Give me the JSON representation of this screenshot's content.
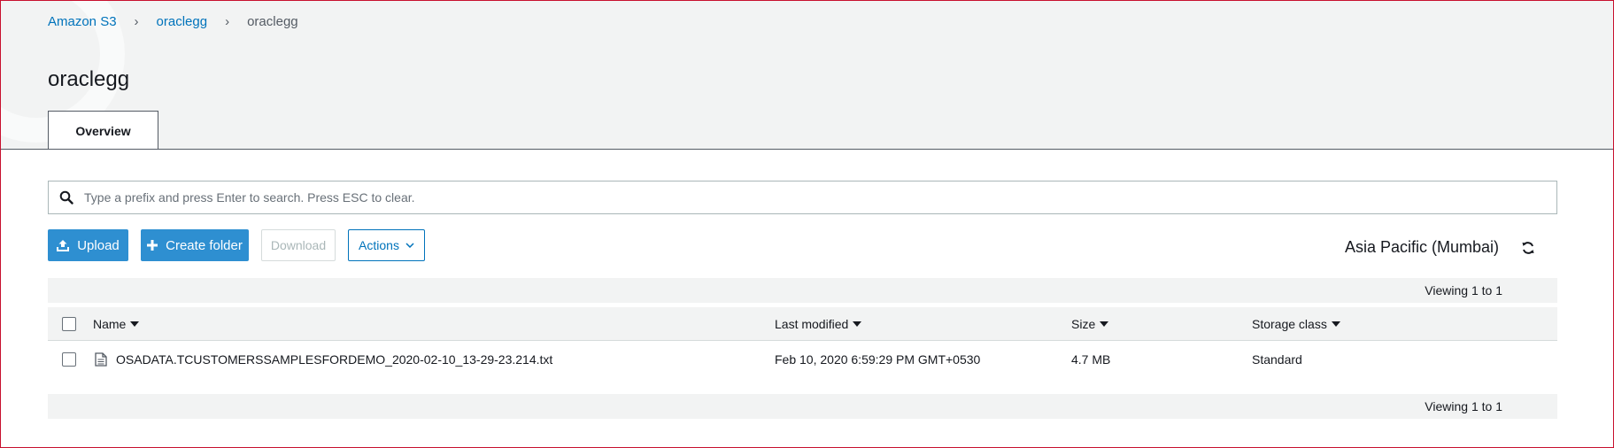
{
  "breadcrumb": {
    "root": "Amazon S3",
    "bucket": "oraclegg",
    "current": "oraclegg"
  },
  "page": {
    "title": "oraclegg"
  },
  "tabs": [
    {
      "label": "Overview",
      "active": true
    }
  ],
  "search": {
    "placeholder": "Type a prefix and press Enter to search. Press ESC to clear.",
    "value": ""
  },
  "toolbar": {
    "upload_label": "Upload",
    "create_folder_label": "Create folder",
    "download_label": "Download",
    "actions_label": "Actions",
    "region": "Asia Pacific (Mumbai)"
  },
  "viewing": {
    "top": "Viewing 1 to 1",
    "bottom": "Viewing 1 to 1"
  },
  "table": {
    "columns": [
      "Name",
      "Last modified",
      "Size",
      "Storage class"
    ],
    "rows": [
      {
        "name": "OSADATA.TCUSTOMERSSAMPLESFORDEMO_2020-02-10_13-29-23.214.txt",
        "last_modified": "Feb 10, 2020 6:59:29 PM GMT+0530",
        "size": "4.7 MB",
        "storage_class": "Standard"
      }
    ]
  },
  "icons": {
    "search": "search-icon",
    "upload": "upload-icon",
    "create_folder": "plus-icon",
    "actions": "chevron-down-icon",
    "refresh": "refresh-icon",
    "file": "file-icon"
  },
  "colors": {
    "primary": "#2e8fd1",
    "link": "#0073bb",
    "header_bg": "#f2f3f3",
    "frame": "#c8102e"
  }
}
